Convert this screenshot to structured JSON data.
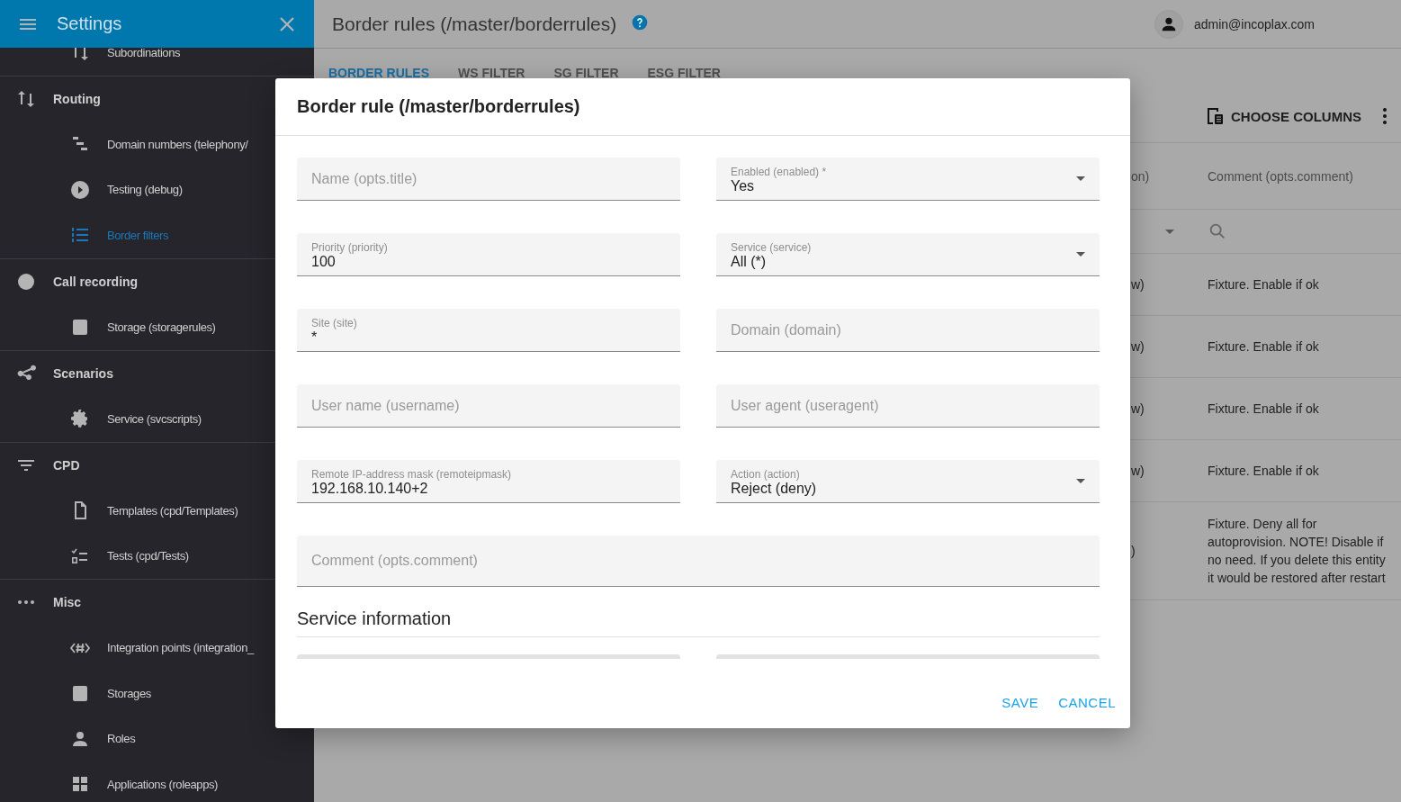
{
  "sidebar": {
    "title": "Settings",
    "sections": [
      {
        "items": [
          {
            "label": "Subordinations",
            "selected": false
          }
        ]
      },
      {
        "title": "Routing",
        "items": [
          {
            "label": "Domain numbers (telephony/",
            "selected": false
          },
          {
            "label": "Testing (debug)",
            "selected": false
          },
          {
            "label": "Border filters",
            "selected": true
          }
        ]
      },
      {
        "title": "Call recording",
        "items": [
          {
            "label": "Storage (storagerules)",
            "selected": false
          }
        ]
      },
      {
        "title": "Scenarios",
        "items": [
          {
            "label": "Service (svcscripts)",
            "selected": false
          }
        ]
      },
      {
        "title": "CPD",
        "items": [
          {
            "label": "Templates (cpd/Templates)",
            "selected": false
          },
          {
            "label": "Tests (cpd/Tests)",
            "selected": false
          }
        ]
      },
      {
        "title": "Misc",
        "items": [
          {
            "label": "Integration points (integration_",
            "selected": false
          },
          {
            "label": "Storages",
            "selected": false
          },
          {
            "label": "Roles",
            "selected": false
          },
          {
            "label": "Applications (roleapps)",
            "selected": false
          }
        ]
      }
    ]
  },
  "page": {
    "title": "Border rules (/master/borderrules)",
    "user": "admin@incoplax.com",
    "tabs": [
      {
        "label": "BORDER RULES",
        "selected": true
      },
      {
        "label": "WS FILTER",
        "selected": false
      },
      {
        "label": "SG FILTER",
        "selected": false
      },
      {
        "label": "ESG FILTER",
        "selected": false
      }
    ],
    "choose_columns": "CHOOSE COLUMNS",
    "table": {
      "columns": [
        "on)",
        "Comment (opts.comment)"
      ],
      "rows": [
        [
          "w)",
          "Fixture. Enable if ok"
        ],
        [
          "w)",
          "Fixture. Enable if ok"
        ],
        [
          "w)",
          "Fixture. Enable if ok"
        ],
        [
          "w)",
          "Fixture. Enable if ok"
        ],
        [
          ")",
          "Fixture. Deny all for autoprovision. NOTE! Disable if no need. If you delete this entity it would be restored after restart"
        ]
      ]
    }
  },
  "dialog": {
    "title": "Border rule (/master/borderrules)",
    "fields": [
      {
        "kind": "text",
        "placeholder": "Name (opts.title)"
      },
      {
        "kind": "select",
        "label": "Enabled (enabled) *",
        "value": "Yes"
      },
      {
        "kind": "text",
        "label": "Priority (priority)",
        "value": "100"
      },
      {
        "kind": "select",
        "label": "Service (service)",
        "value": "All (*)"
      },
      {
        "kind": "text",
        "label": "Site (site)",
        "value": "*"
      },
      {
        "kind": "text",
        "placeholder": "Domain (domain)"
      },
      {
        "kind": "text",
        "placeholder": "User name (username)"
      },
      {
        "kind": "text",
        "placeholder": "User agent (useragent)"
      },
      {
        "kind": "text",
        "label": "Remote IP-address mask (remoteipmask)",
        "value": "192.168.10.140+2"
      },
      {
        "kind": "select",
        "label": "Action (action)",
        "value": "Reject (deny)"
      },
      {
        "kind": "textarea",
        "placeholder": "Comment (opts.comment)"
      }
    ],
    "section": {
      "title": "Service information",
      "fields": [
        {
          "kind": "text"
        },
        {
          "kind": "text"
        }
      ]
    },
    "actions": [
      "SAVE",
      "CANCEL"
    ]
  }
}
